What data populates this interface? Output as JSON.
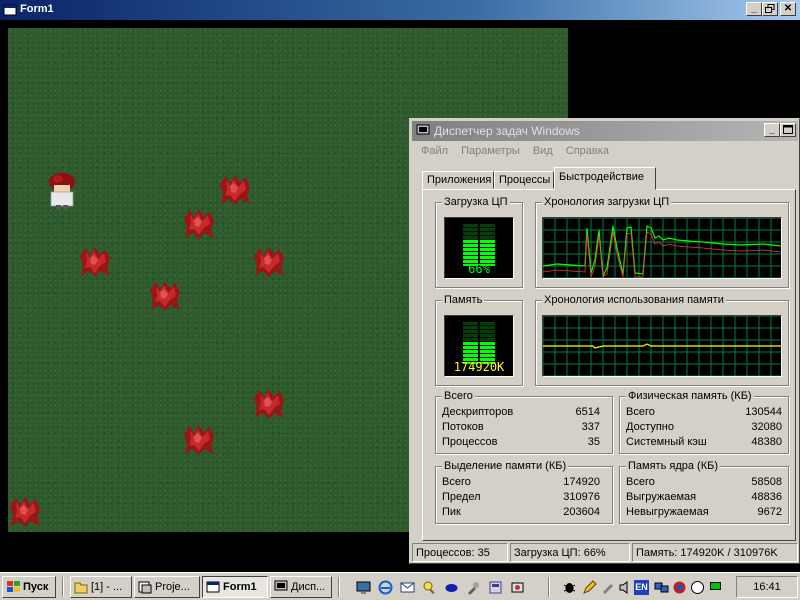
{
  "form1": {
    "title": "Form1",
    "icons": {
      "app": "vb-form-icon",
      "minimize": "minimize-icon",
      "restore": "restore-icon",
      "close": "close-icon"
    }
  },
  "game": {
    "background_color": "#2f5a2e",
    "player": {
      "icon": "player-character-icon"
    },
    "crystal_count": 10
  },
  "taskmgr": {
    "title": "Диспетчер задач Windows",
    "menu": [
      "Файл",
      "Параметры",
      "Вид",
      "Справка"
    ],
    "tabs": [
      "Приложения",
      "Процессы",
      "Быстродействие"
    ],
    "active_tab": "Быстродействие",
    "cpu_usage": {
      "title": "Загрузка ЦП",
      "value": "66%",
      "fraction": 0.66
    },
    "cpu_history": {
      "title": "Хронология загрузки ЦП"
    },
    "memory": {
      "title": "Память",
      "value": "174920K",
      "fraction": 0.5
    },
    "memory_history": {
      "title": "Хронология использования памяти"
    },
    "totals": {
      "title": "Всего",
      "rows": [
        {
          "label": "Дескрипторов",
          "value": "6514"
        },
        {
          "label": "Потоков",
          "value": "337"
        },
        {
          "label": "Процессов",
          "value": "35"
        }
      ]
    },
    "physical": {
      "title": "Физическая память (КБ)",
      "rows": [
        {
          "label": "Всего",
          "value": "130544"
        },
        {
          "label": "Доступно",
          "value": "32080"
        },
        {
          "label": "Системный кэш",
          "value": "48380"
        }
      ]
    },
    "commit": {
      "title": "Выделение памяти (КБ)",
      "rows": [
        {
          "label": "Всего",
          "value": "174920"
        },
        {
          "label": "Предел",
          "value": "310976"
        },
        {
          "label": "Пик",
          "value": "203604"
        }
      ]
    },
    "kernel": {
      "title": "Память ядра (КБ)",
      "rows": [
        {
          "label": "Всего",
          "value": "58508"
        },
        {
          "label": "Выгружаемая",
          "value": "48836"
        },
        {
          "label": "Невыгружаемая",
          "value": "9672"
        }
      ]
    },
    "statusbar": {
      "processes": "Процессов: 35",
      "cpu": "Загрузка ЦП: 66%",
      "memory": "Память: 174920K / 310976K"
    }
  },
  "taskbar": {
    "start": "Пуск",
    "tasks": [
      {
        "label": "[1] - ...",
        "icon": "folder-icon",
        "active": false
      },
      {
        "label": "Proje...",
        "icon": "vb-project-icon",
        "active": false
      },
      {
        "label": "Form1",
        "icon": "form-window-icon",
        "active": true
      },
      {
        "label": "Дисп...",
        "icon": "task-manager-icon",
        "active": false
      }
    ],
    "quicklaunch_icons": [
      "desktop-icon",
      "ie-icon",
      "outlook-icon",
      "search-icon",
      "media-icon",
      "tool-icon",
      "app-icon",
      "app2-icon"
    ],
    "tray_icons": [
      "bug-icon",
      "pen-icon",
      "tool2-icon",
      "volume-icon",
      "language-en-icon",
      "network-icon",
      "shield-icon",
      "circle-icon",
      "monitor-icon"
    ],
    "language": "EN",
    "clock": "16:41"
  }
}
